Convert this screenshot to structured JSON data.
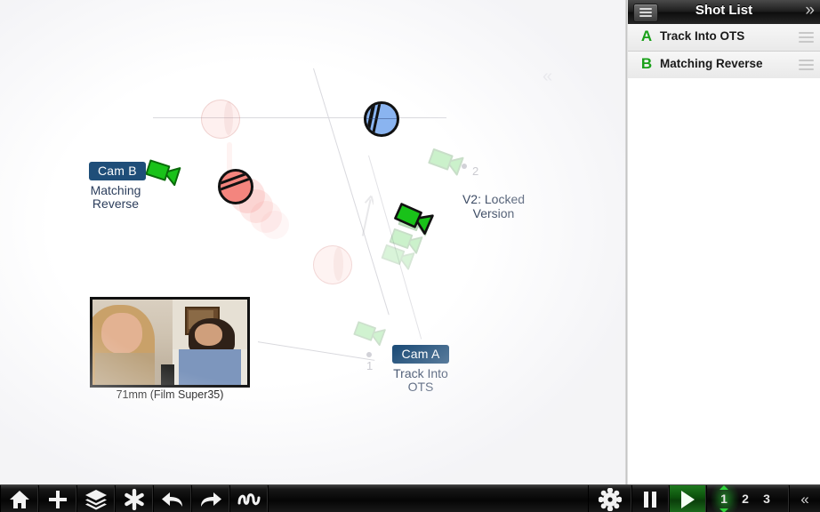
{
  "app": {
    "sidebar": {
      "title": "Shot List",
      "menu_icon": "hamburger-icon",
      "collapse_icon": "»",
      "shots": [
        {
          "letter": "A",
          "name": "Track Into OTS"
        },
        {
          "letter": "B",
          "name": "Matching Reverse"
        }
      ]
    },
    "canvas": {
      "collapse_icon": "«",
      "version_label": "V2: Locked\nVersion",
      "version_label_line1": "V2: Locked",
      "version_label_line2": "Version",
      "cameras": [
        {
          "tag": "Cam B",
          "sub_line1": "Matching",
          "sub_line2": "Reverse",
          "track_number": "",
          "color": "#19c219"
        },
        {
          "tag": "Cam A",
          "sub_line1": "Track Into",
          "sub_line2": "OTS",
          "track_number": "",
          "color": "#19c219"
        }
      ],
      "track_numbers": [
        "1",
        "2"
      ],
      "preview": {
        "caption": "71mm (Film Super35)"
      },
      "characters": [
        {
          "name": "character-blue",
          "color": "#8ab4f0"
        },
        {
          "name": "character-red",
          "color": "#f4857e"
        }
      ]
    },
    "toolbar": {
      "left_items": [
        {
          "name": "home-button",
          "icon": "home-icon"
        },
        {
          "name": "add-button",
          "icon": "plus-icon"
        },
        {
          "name": "layers-button",
          "icon": "layers-icon"
        },
        {
          "name": "effects-button",
          "icon": "asterisk-icon"
        },
        {
          "name": "undo-button",
          "icon": "undo-arrow-icon"
        },
        {
          "name": "redo-button",
          "icon": "redo-arrow-icon"
        },
        {
          "name": "freehand-button",
          "icon": "squiggle-icon"
        }
      ],
      "right_items": [
        {
          "name": "settings-button",
          "icon": "gear-icon"
        },
        {
          "name": "pause-button",
          "icon": "pause-icon"
        },
        {
          "name": "play-button",
          "icon": "play-icon"
        }
      ],
      "speed_options": [
        "1",
        "2",
        "3"
      ],
      "speed_selected": "1",
      "collapse_icon": "«"
    },
    "colors": {
      "accent_green": "#19a019",
      "cam_tag_blue": "#1f4e79",
      "label_text": "#2c3e5c",
      "character_blue": "#8ab4f0",
      "character_red": "#f4857e"
    }
  }
}
